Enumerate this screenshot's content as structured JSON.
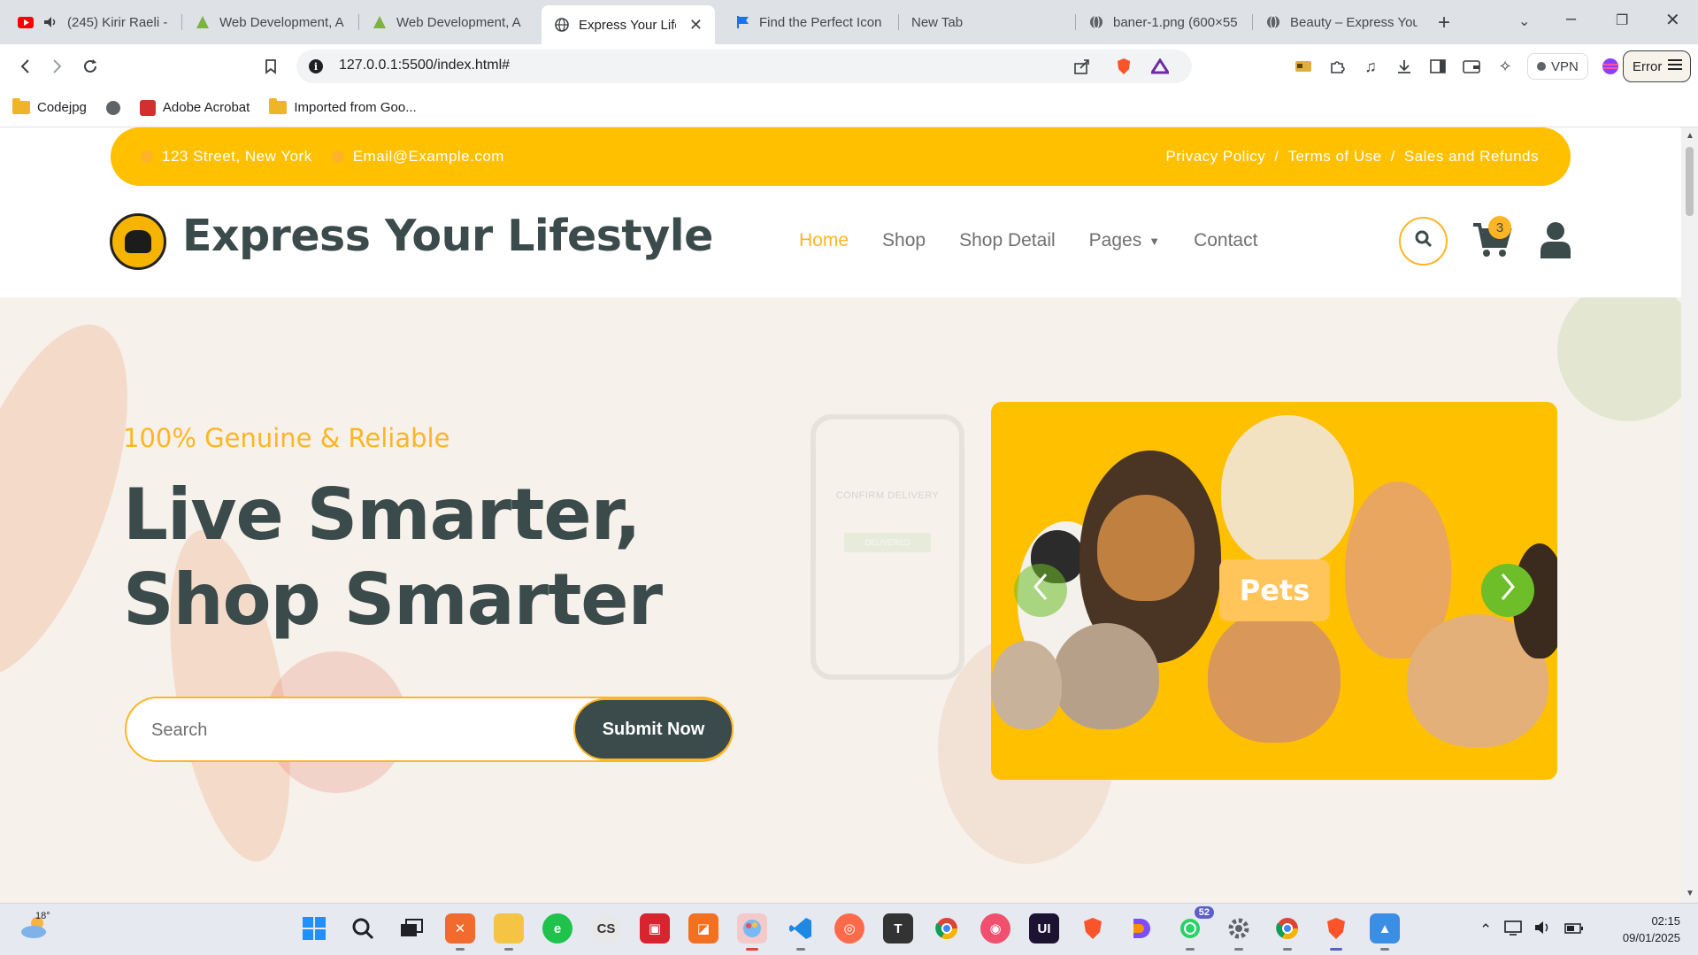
{
  "browser": {
    "tabs": [
      {
        "label": "(245) Kirir Raeli -",
        "icon": "youtube-icon",
        "audio": true
      },
      {
        "label": "Web Development, A",
        "icon": "course-icon"
      },
      {
        "label": "Web Development, A",
        "icon": "course-icon"
      },
      {
        "label": "Express Your Life",
        "icon": "globe-icon",
        "active": true
      },
      {
        "label": "Find the Perfect Icon",
        "icon": "flag-icon"
      },
      {
        "label": "New Tab",
        "icon": ""
      },
      {
        "label": "baner-1.png (600×55",
        "icon": "globe-icon"
      },
      {
        "label": "Beauty – Express You",
        "icon": "globe-icon"
      }
    ],
    "url": "127.0.0.1:5500/index.html#",
    "vpn_label": "VPN",
    "error_label": "Error",
    "bookmarks": [
      {
        "label": "Codejpg",
        "icon": "folder-icon"
      },
      {
        "label": "",
        "icon": "globe-icon"
      },
      {
        "label": "Adobe Acrobat",
        "icon": "acrobat-icon"
      },
      {
        "label": "Imported from Goo...",
        "icon": "folder-icon"
      }
    ]
  },
  "site": {
    "topbar": {
      "address": "123 Street, New York",
      "email": "Email@Example.com",
      "links": [
        "Privacy Policy",
        "Terms of Use",
        "Sales and Refunds"
      ],
      "separator": "/"
    },
    "brand": "Express Your Lifestyle",
    "nav": {
      "home": "Home",
      "shop": "Shop",
      "shop_detail": "Shop Detail",
      "pages": "Pages",
      "contact": "Contact"
    },
    "cart_count": "3",
    "hero": {
      "subtitle": "100% Genuine & Reliable",
      "title": "Live Smarter, Shop Smarter",
      "search_placeholder": "Search",
      "submit_label": "Submit Now",
      "phone_text": "CONFIRM DELIVERY",
      "phone_button": "DELIVERED",
      "carousel_label": "Pets"
    },
    "colors": {
      "accent": "#ffb524",
      "topbar": "#ffc000",
      "dark": "#3b4a4a",
      "arrow": "#6ebe2a"
    }
  },
  "taskbar": {
    "weather_temp": "18°",
    "whatsapp_badge": "52",
    "time": "02:15",
    "date": "09/01/2025"
  }
}
